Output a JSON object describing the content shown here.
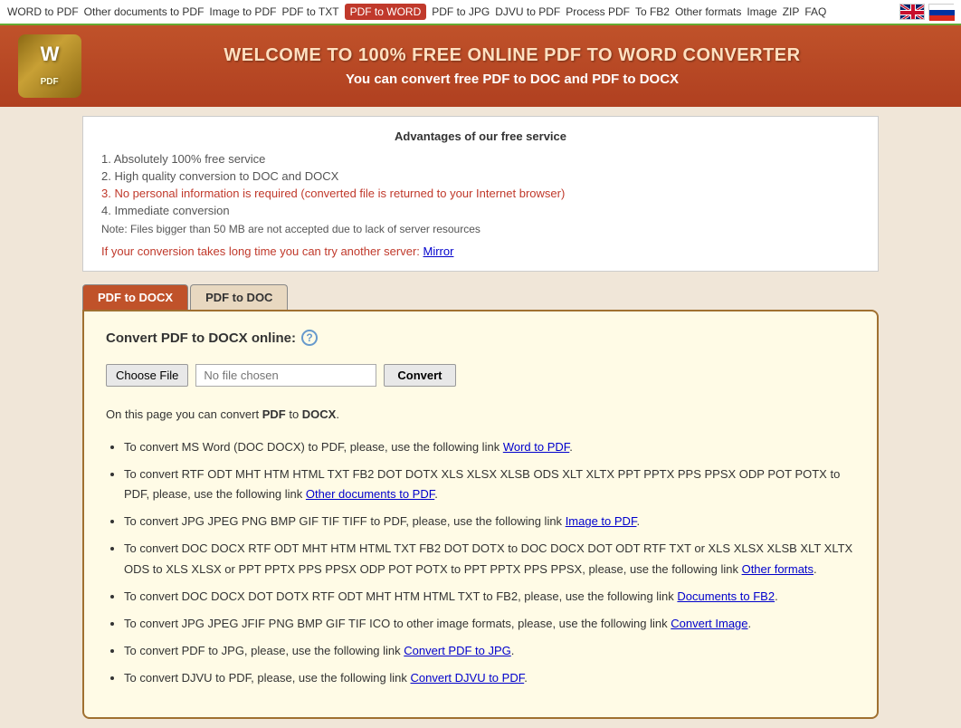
{
  "nav": {
    "items": [
      {
        "label": "WORD to PDF",
        "href": "#",
        "active": false
      },
      {
        "label": "Other documents to PDF",
        "href": "#",
        "active": false
      },
      {
        "label": "Image to PDF",
        "href": "#",
        "active": false
      },
      {
        "label": "PDF to TXT",
        "href": "#",
        "active": false
      },
      {
        "label": "PDF to WORD",
        "href": "#",
        "active": true
      },
      {
        "label": "PDF to JPG",
        "href": "#",
        "active": false
      },
      {
        "label": "DJVU to PDF",
        "href": "#",
        "active": false
      },
      {
        "label": "Process PDF",
        "href": "#",
        "active": false
      },
      {
        "label": "To FB2",
        "href": "#",
        "active": false
      },
      {
        "label": "Other formats",
        "href": "#",
        "active": false
      },
      {
        "label": "Image",
        "href": "#",
        "active": false
      },
      {
        "label": "ZIP",
        "href": "#",
        "active": false
      },
      {
        "label": "FAQ",
        "href": "#",
        "active": false
      }
    ]
  },
  "header": {
    "title": "WELCOME TO 100% FREE ONLINE PDF TO WORD CONVERTER",
    "subtitle": "You can convert free PDF to DOC and PDF to DOCX"
  },
  "advantages": {
    "section_title": "Advantages of our free service",
    "items": [
      "1. Absolutely 100% free service",
      "2. High quality conversion to DOC and DOCX",
      "3. No personal information is required (converted file is returned to your Internet browser)",
      "4. Immediate conversion"
    ],
    "note": "Note: Files bigger than 50 MB are not accepted due to lack of server resources",
    "mirror_text": "If your conversion takes long time you can try another server:",
    "mirror_link_label": "Mirror"
  },
  "tabs": [
    {
      "label": "PDF to DOCX",
      "active": true
    },
    {
      "label": "PDF to DOC",
      "active": false
    }
  ],
  "converter": {
    "label": "Convert PDF to DOCX online:",
    "choose_file_btn": "Choose File",
    "file_placeholder": "No file chosen",
    "convert_btn": "Convert"
  },
  "description": {
    "main": "On this page you can convert PDF to DOCX.",
    "links": [
      {
        "text_before": "To convert MS Word (DOC DOCX) to PDF, please, use the following link",
        "link_label": "Word to PDF",
        "text_after": "."
      },
      {
        "text_before": "To convert RTF ODT MHT HTM HTML TXT FB2 DOT DOTX XLS XLSX XLSB ODS XLT XLTX PPT PPTX PPS PPSX ODP POT POTX to PDF, please, use the following link",
        "link_label": "Other documents to PDF",
        "text_after": "."
      },
      {
        "text_before": "To convert JPG JPEG PNG BMP GIF TIF TIFF to PDF, please, use the following link",
        "link_label": "Image to PDF",
        "text_after": "."
      },
      {
        "text_before": "To convert DOC DOCX RTF ODT MHT HTM HTML TXT FB2 DOT DOTX to DOC DOCX DOT ODT RTF TXT or XLS XLSX XLSB XLT XLTX ODS to XLS XLSX or PPT PPTX PPS PPSX ODP POT POTX to PPT PPTX PPS PPSX, please, use the following link",
        "link_label": "Other formats",
        "text_after": "."
      },
      {
        "text_before": "To convert DOC DOCX DOT DOTX RTF ODT MHT HTM HTML TXT to FB2, please, use the following link",
        "link_label": "Documents to FB2",
        "text_after": "."
      },
      {
        "text_before": "To convert JPG JPEG JFIF PNG BMP GIF TIF ICO to other image formats, please, use the following link",
        "link_label": "Convert Image",
        "text_after": "."
      },
      {
        "text_before": "To convert PDF to JPG, please, use the following link",
        "link_label": "Convert PDF to JPG",
        "text_after": "."
      },
      {
        "text_before": "To convert DJVU to PDF, please, use the following link",
        "link_label": "Convert DJVU to PDF",
        "text_after": "."
      }
    ]
  }
}
